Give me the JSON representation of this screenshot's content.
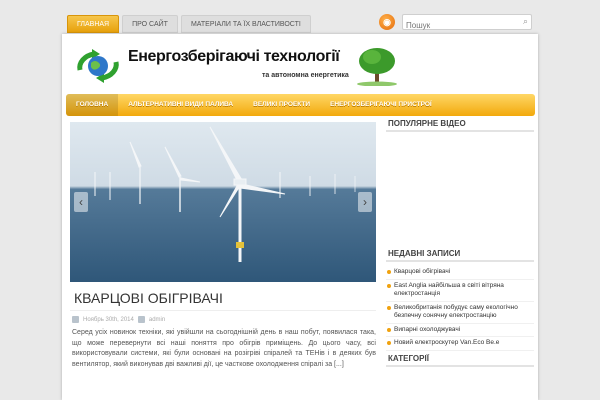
{
  "topnav": {
    "items": [
      "ГЛАВНАЯ",
      "ПРО САЙТ",
      "МАТЕРІАЛИ ТА ЇХ ВЛАСТИВОСТІ"
    ]
  },
  "search": {
    "placeholder": "Пошук"
  },
  "header": {
    "title": "Енергозберігаючі технології",
    "subtitle": "та автономна енергетика"
  },
  "mainnav": {
    "items": [
      "ГОЛОВНА",
      "АЛЬТЕРНАТИВНІ ВИДИ ПАЛИВА",
      "ВЕЛИКІ ПРОЕКТИ",
      "ЕНЕРГОЗБЕРІГАЮЧІ ПРИСТРОЇ"
    ]
  },
  "post": {
    "title": "КВАРЦОВІ ОБІГРІВАЧІ",
    "date": "Ноябрь 30th, 2014",
    "author": "admin",
    "excerpt": "Серед усіх новинок техніки, які увійшли на сьогоднішній день в наш побут, появилася така, що може перевернути всі наші поняття про обігрів приміщень. До цього часу, всі використовували системи, які були основані на розігріві спіралей та ТЕНів і в деяких був вентилятор, який виконував дві важливі дії, це часткове охолодження спіралі за [...]"
  },
  "sidebar": {
    "video_title": "ПОПУЛЯРНЕ ВІДЕО",
    "recent_title": "НЕДАВНІ ЗАПИСИ",
    "recent": [
      "Кварцові обігрівачі",
      "East Anglia найбільша в світі вітряна електростанція",
      "Великобританія побудує саму екологічно безпечну сонячну електростанцію",
      "Випарні охолоджувачі",
      "Новий електроскутер Van.Eco Be.e"
    ],
    "categories_title": "КАТЕГОРІЇ"
  },
  "colors": {
    "accent": "#f2a90c",
    "nav_light": "#ffd766"
  }
}
